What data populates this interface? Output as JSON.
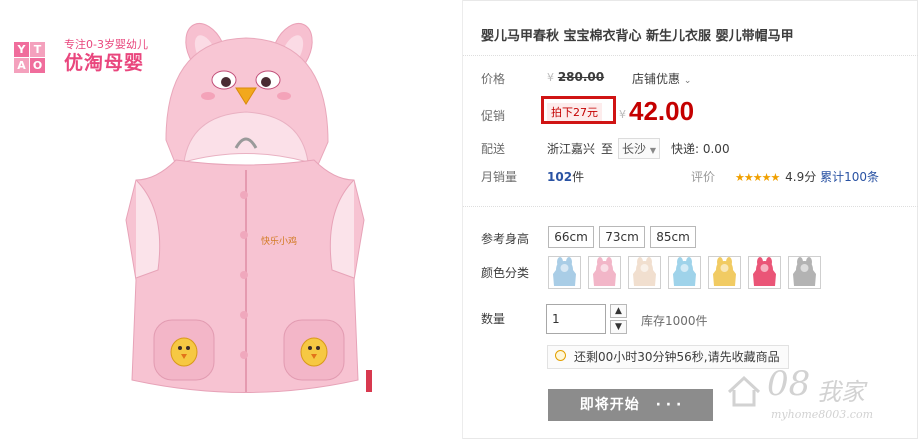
{
  "brand": {
    "mark": [
      "Y",
      "T",
      "A",
      "O"
    ],
    "slogan": "专注0-3岁婴幼儿",
    "name": "优淘母婴"
  },
  "product": {
    "title": "婴儿马甲春秋 宝宝棉衣背心 新生儿衣服 婴儿带帽马甲",
    "image": "pink hooded baby vest with chick pockets",
    "garment_text": "快乐小鸡"
  },
  "price": {
    "label": "价格",
    "currency": "¥",
    "original": "280.00",
    "shop_promo": "店铺优惠",
    "dropdown_icon": "chevron-down-icon"
  },
  "promo": {
    "label": "促销",
    "tag": "拍下27元",
    "currency": "¥",
    "amount": "42.00",
    "highlight_color": "#d01414"
  },
  "delivery": {
    "label": "配送",
    "origin": "浙江嘉兴",
    "to": "至",
    "destination": "长沙",
    "express": "快递: 0.00"
  },
  "sales": {
    "label": "月销量",
    "count": "102",
    "unit": "件",
    "rating_label": "评价",
    "stars": "★★★★★",
    "score": "4.9分",
    "reviews": "累计100条"
  },
  "size": {
    "label": "参考身高",
    "options": [
      "66cm",
      "73cm",
      "85cm"
    ]
  },
  "color": {
    "label": "颜色分类",
    "swatches": [
      "#a9cde6",
      "#f2b6c8",
      "#f1dfcf",
      "#9fd3ea",
      "#f1cb63",
      "#ea5577",
      "#b3b3b3"
    ]
  },
  "quantity": {
    "label": "数量",
    "value": "1",
    "stock": "库存1000件"
  },
  "countdown": {
    "text": "还剩00小时30分钟56秒,请先收藏商品"
  },
  "action": {
    "start": "即将开始",
    "dots": "· · ·"
  },
  "watermark": {
    "logo": "08",
    "cn": "我家",
    "url": "myhome8003.com"
  },
  "colors": {
    "accent": "#c40000",
    "link": "#2952a3",
    "brand": "#e9467d",
    "button": "#8c8c8c"
  }
}
